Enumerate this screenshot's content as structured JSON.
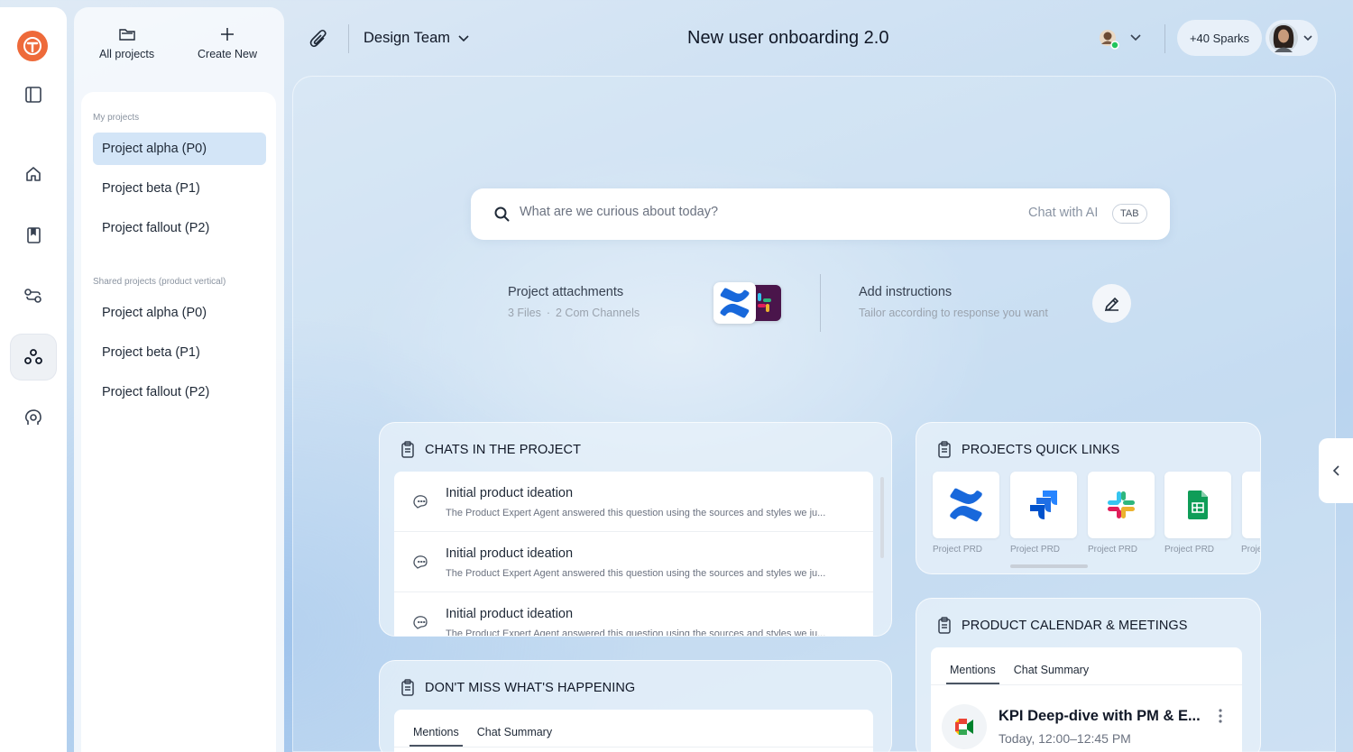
{
  "header": {
    "team_name": "Design Team",
    "page_title": "New user onboarding 2.0",
    "sparks_label": "+40 Sparks"
  },
  "projects_panel": {
    "all_projects_label": "All projects",
    "create_new_label": "Create New",
    "my_projects_label": "My projects",
    "my_projects": [
      "Project alpha (P0)",
      "Project beta (P1)",
      "Project fallout (P2)"
    ],
    "shared_label": "Shared projects (product vertical)",
    "shared_projects": [
      "Project alpha (P0)",
      "Project beta (P1)",
      "Project fallout (P2)"
    ]
  },
  "search": {
    "placeholder": "What are we curious about today?",
    "chat_ai_label": "Chat with AI",
    "tab_hint": "TAB"
  },
  "attachments": {
    "title": "Project attachments",
    "files": "3 Files",
    "separator": "·",
    "channels": "2 Com Channels"
  },
  "instructions": {
    "title": "Add instructions",
    "subtitle": "Tailor according to response you want"
  },
  "chats_panel": {
    "title": "CHATS IN THE PROJECT",
    "items": [
      {
        "title": "Initial product ideation",
        "desc": "The Product Expert Agent answered this question using the sources and styles we ju..."
      },
      {
        "title": "Initial product ideation",
        "desc": "The Product Expert Agent answered this question using the sources and styles we ju..."
      },
      {
        "title": "Initial product ideation",
        "desc": "The Product Expert Agent answered this question using the sources and styles we ju..."
      }
    ]
  },
  "quick_links": {
    "title": "PROJECTS QUICK LINKS",
    "items": [
      {
        "label": "Project PRD",
        "icon": "confluence-icon"
      },
      {
        "label": "Project PRD",
        "icon": "jira-icon"
      },
      {
        "label": "Project PRD",
        "icon": "slack-icon"
      },
      {
        "label": "Project PRD",
        "icon": "google-sheets-icon"
      },
      {
        "label": "Proje",
        "icon": "partial-tile"
      }
    ]
  },
  "happening_panel": {
    "title": "DON'T MISS WHAT'S HAPPENING",
    "tabs": [
      "Mentions",
      "Chat Summary"
    ]
  },
  "calendar_panel": {
    "title": "PRODUCT CALENDAR & MEETINGS",
    "tabs": [
      "Mentions",
      "Chat Summary"
    ],
    "meeting_title": "KPI Deep-dive with PM & E...",
    "meeting_time": "Today, 12:00–12:45 PM"
  },
  "colors": {
    "brand": "#ee6a3a",
    "active_project_bg": "#d3e5f7",
    "status_online": "#22c55e"
  }
}
